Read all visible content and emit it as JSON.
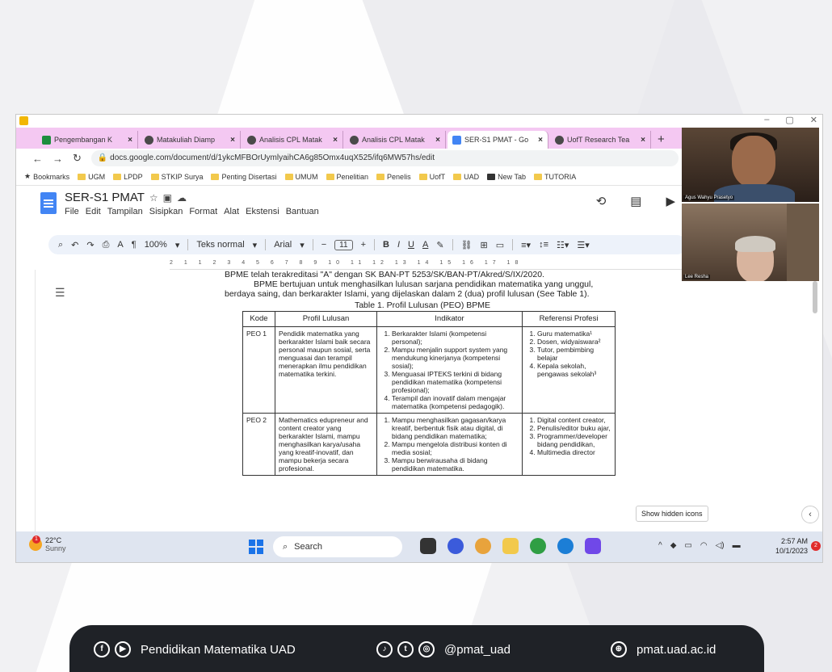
{
  "window": {
    "controls": [
      "–",
      "▢",
      "✕"
    ]
  },
  "tabs": [
    {
      "label": "Pengembangan K",
      "fav": "g",
      "active": false
    },
    {
      "label": "Matakuliah Diamp",
      "fav": "",
      "active": false
    },
    {
      "label": "Analisis CPL Matak",
      "fav": "",
      "active": false
    },
    {
      "label": "Analisis CPL Matak",
      "fav": "",
      "active": false
    },
    {
      "label": "SER-S1 PMAT - Go",
      "fav": "d",
      "active": true
    },
    {
      "label": "UofT Research Tea",
      "fav": "",
      "active": false
    }
  ],
  "address": {
    "url": "docs.google.com/document/d/1ykcMFBOrUymlyaihCA6g85Omx4uqX525/ifq6MW57hs/edit"
  },
  "bookmarks": [
    "Bookmarks",
    "UGM",
    "LPDP",
    "STKIP Surya",
    "Penting Disertasi",
    "UMUM",
    "Penelitian",
    "Penelis",
    "UofT",
    "UAD",
    "New Tab",
    "TUTORIA"
  ],
  "doc": {
    "title": "SER-S1 PMAT",
    "menus": [
      "File",
      "Edit",
      "Tampilan",
      "Sisipkan",
      "Format",
      "Alat",
      "Ekstensi",
      "Bantuan"
    ]
  },
  "toolbar": {
    "zoom": "100%",
    "style": "Teks normal",
    "font": "Arial",
    "size": "11"
  },
  "ruler": "2 1 1 2 3 4 5 6 7 8 9 10 11 12 13 14 15 16 17 18",
  "content": {
    "line1": "BPME telah terakreditasi \"A\" dengan SK BAN-PT 5253/SK/BAN-PT/Akred/S/IX/2020.",
    "para": "BPME bertujuan untuk menghasilkan lulusan sarjana pendidikan matematika yang unggul, berdaya saing, dan berkarakter Islami, yang dijelaskan dalam 2 (dua) profil lulusan (See Table 1).",
    "caption": "Table 1. Profil Lulusan (PEO) BPME",
    "headers": [
      "Kode",
      "Profil Lulusan",
      "Indikator",
      "Referensi Profesi"
    ],
    "row1": {
      "kode": "PEO 1",
      "profil": "Pendidik matematika yang berkarakter Islami baik secara personal maupun sosial, serta menguasai dan terampil menerapkan ilmu pendidikan matematika terkini.",
      "indikator": [
        "Berkarakter Islami (kompetensi personal);",
        "Mampu menjalin support system yang mendukung kinerjanya (kompetensi sosial);",
        "Menguasai IPTEKS terkini di bidang pendidikan matematika (kompetensi profesional);",
        "Terampil dan inovatif dalam mengajar matematika (kompetensi pedagogik)."
      ],
      "referensi": [
        "Guru matematika¹",
        "Dosen, widyaiswara²",
        "Tutor, pembimbing belajar",
        "Kepala sekolah, pengawas sekolah³"
      ]
    },
    "row2": {
      "kode": "PEO 2",
      "profil": "Mathematics edupreneur and content creator yang berkarakter Islami, mampu menghasilkan karya/usaha yang kreatif-inovatif, dan mampu bekerja secara profesional.",
      "indikator": [
        "Mampu menghasilkan gagasan/karya kreatif, berbentuk fisik atau digital, di bidang pendidikan matematika;",
        "Mampu mengelola distribusi konten di media sosial;",
        "Mampu berwirausaha di bidang pendidikan matematika."
      ],
      "referensi": [
        "Digital content creator,",
        "Penulis/editor buku ajar,",
        "Programmer/developer bidang pendidikan,",
        "Multimedia director"
      ]
    }
  },
  "video": {
    "name1": "Agus Wahyu Prasetyo",
    "name2": "Lee Resha"
  },
  "tooltip": "Show hidden icons",
  "taskbar": {
    "temp": "22°C",
    "weather": "Sunny",
    "badge": "1",
    "search": "Search",
    "time": "2:57 AM",
    "date": "10/1/2023",
    "notif": "2"
  },
  "footer": {
    "name": "Pendidikan Matematika UAD",
    "handle": "@pmat_uad",
    "site": "pmat.uad.ac.id"
  },
  "colors": {
    "tabbar": "#f4c8f2",
    "footer": "#1f2227",
    "docs_blue": "#4285f4"
  }
}
